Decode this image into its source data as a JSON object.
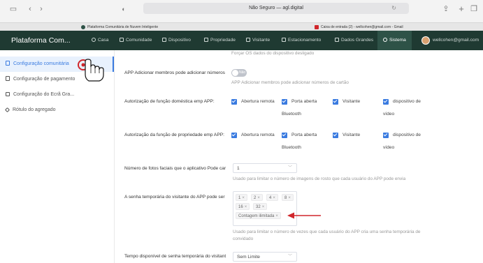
{
  "browser": {
    "address": "Não Seguro — agl.digital",
    "tabs": [
      {
        "label": "Plataforma Comunitária de Nuvem Inteligente"
      },
      {
        "label": "Caixa de entrada (2) - wellcohen@gmail.com - Gmail"
      }
    ]
  },
  "app": {
    "brand": "Plataforma Com...",
    "nav": [
      {
        "label": "Casa"
      },
      {
        "label": "Comunidade"
      },
      {
        "label": "Dispositivo"
      },
      {
        "label": "Propriedade"
      },
      {
        "label": "Visitante"
      },
      {
        "label": "Estacionamento"
      },
      {
        "label": "Dados Grandes"
      },
      {
        "label": "Sistema"
      }
    ],
    "user_email": "wellcohen@gmail.com"
  },
  "sidebar": {
    "items": [
      {
        "label": "Configuração comunitária"
      },
      {
        "label": "Configuração de pagamento"
      },
      {
        "label": "Configuração do Ecrã Gra..."
      },
      {
        "label": "Rótulo do agregado"
      }
    ]
  },
  "main": {
    "top_hint": "Forçar OS dados do dispositivo desligado",
    "add_members": {
      "label": "APP Adicionar membros pode adicionar números",
      "toggle_text": "Não",
      "toggle_on": false,
      "hint": "APP Adicionar membros pode adicionar números de cartão"
    },
    "home_auth": {
      "label": "Autorização de função doméstica emp APP:",
      "options": [
        "Abertura remota",
        "Porta aberta",
        "Visitante",
        "dispositivo de"
      ],
      "sub": [
        "Bluetooth",
        "vídeo"
      ]
    },
    "property_auth": {
      "label": "Autorização da função de propriedade emp APP:",
      "options": [
        "Abertura remota",
        "Porta aberta",
        "Visitante",
        "dispositivo de"
      ],
      "sub": [
        "Bluetooth",
        "vídeo"
      ]
    },
    "face_photos": {
      "label": "Número de fotos faciais que o aplicativo Pode car",
      "value": "1",
      "hint": "Usado para limitar o número de imagens de rosto que cada usuário do APP pode envia"
    },
    "temp_password": {
      "label": "A senha temporária do visitante do APP pode ser",
      "tags": [
        "1",
        "2",
        "4",
        "8",
        "16",
        "32",
        "Contagem ilimitada"
      ],
      "hint_line1": "Usado para limitar o número de vezes que cada usuário do APP cria uma senha temporária de",
      "hint_line2": "convidado"
    },
    "temp_time": {
      "label": "Tempo disponível de senha temporária do visitant",
      "value": "Sem Limite"
    }
  },
  "colors": {
    "nav_bg": "#1f3a32",
    "accent": "#3a7be0",
    "annotation": "#d0262b"
  }
}
